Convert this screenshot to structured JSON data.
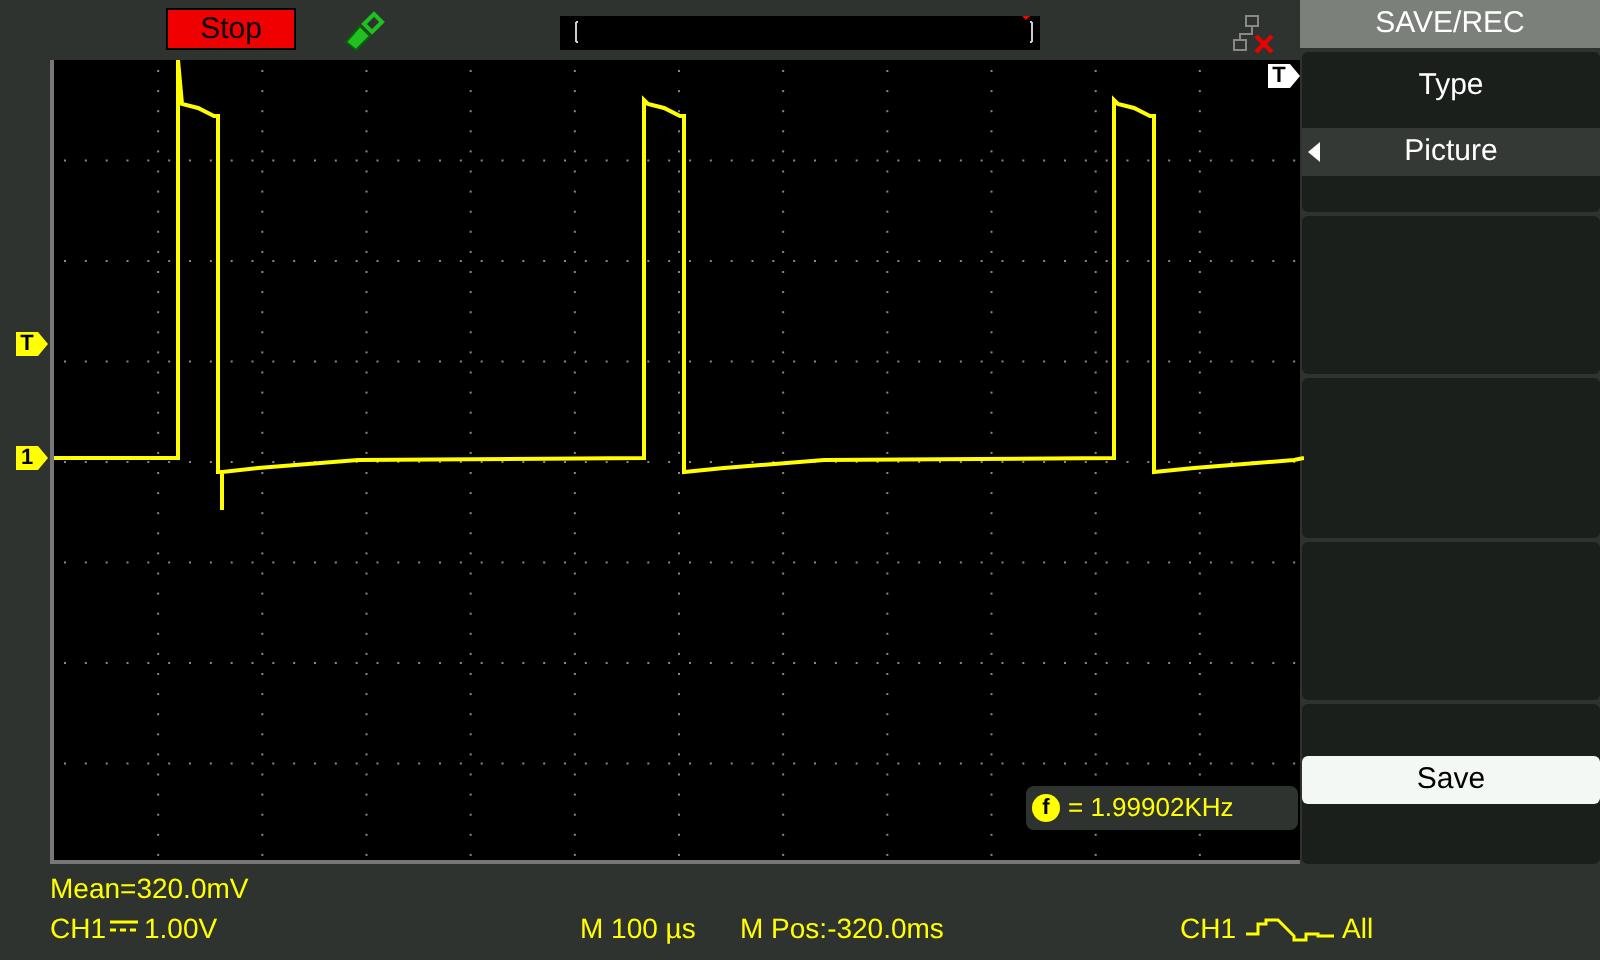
{
  "top_bar": {
    "run_state": "Stop"
  },
  "plot": {
    "trigger_marker_top": "T",
    "trigger_level_marker": "T",
    "channel_marker": "1",
    "frequency": {
      "icon_letter": "f",
      "reading": "= 1.99902KHz"
    }
  },
  "menu": {
    "title": "SAVE/REC",
    "items": [
      {
        "kind": "option",
        "label": "Type",
        "value": "Picture"
      },
      {
        "kind": "empty"
      },
      {
        "kind": "empty"
      },
      {
        "kind": "empty"
      },
      {
        "kind": "button",
        "label": "Save"
      }
    ]
  },
  "status_bar": {
    "measurement": "Mean=320.0mV",
    "channel": "CH1",
    "volts_per_div": "1.00V",
    "time_base": "M 100 µs",
    "position": "M Pos:-320.0ms",
    "trigger_source": "CH1",
    "trigger_mode": "All"
  }
}
